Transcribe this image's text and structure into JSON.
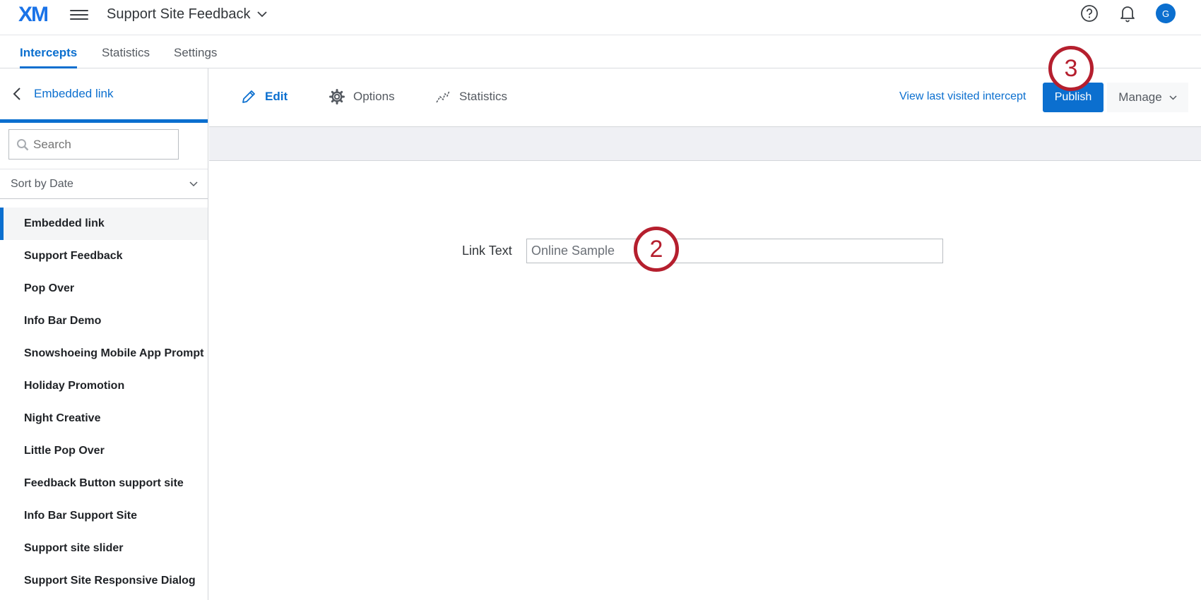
{
  "header": {
    "logo": "XM",
    "project_title": "Support Site Feedback",
    "avatar_initial": "G"
  },
  "tabs": [
    {
      "label": "Intercepts",
      "active": true
    },
    {
      "label": "Statistics",
      "active": false
    },
    {
      "label": "Settings",
      "active": false
    }
  ],
  "sidebar": {
    "back_label": "Embedded link",
    "search_placeholder": "Search",
    "sort_label": "Sort by Date",
    "items": [
      {
        "label": "Embedded link",
        "selected": true
      },
      {
        "label": "Support Feedback"
      },
      {
        "label": "Pop Over"
      },
      {
        "label": "Info Bar Demo"
      },
      {
        "label": "Snowshoeing Mobile App Prompt"
      },
      {
        "label": "Holiday Promotion"
      },
      {
        "label": "Night Creative"
      },
      {
        "label": "Little Pop Over"
      },
      {
        "label": "Feedback Button support site"
      },
      {
        "label": "Info Bar Support Site"
      },
      {
        "label": "Support site slider"
      },
      {
        "label": "Support Site Responsive Dialog"
      }
    ]
  },
  "toolbar": {
    "edit_label": "Edit",
    "options_label": "Options",
    "statistics_label": "Statistics",
    "last_visited_label": "View last visited intercept",
    "publish_label": "Publish",
    "manage_label": "Manage"
  },
  "form": {
    "link_text_label": "Link Text",
    "link_text_value": "Online Sample"
  },
  "callouts": {
    "step_two": "2",
    "step_three": "3"
  },
  "colors": {
    "accent": "#0b6fcf",
    "callout": "#b51f2e"
  }
}
